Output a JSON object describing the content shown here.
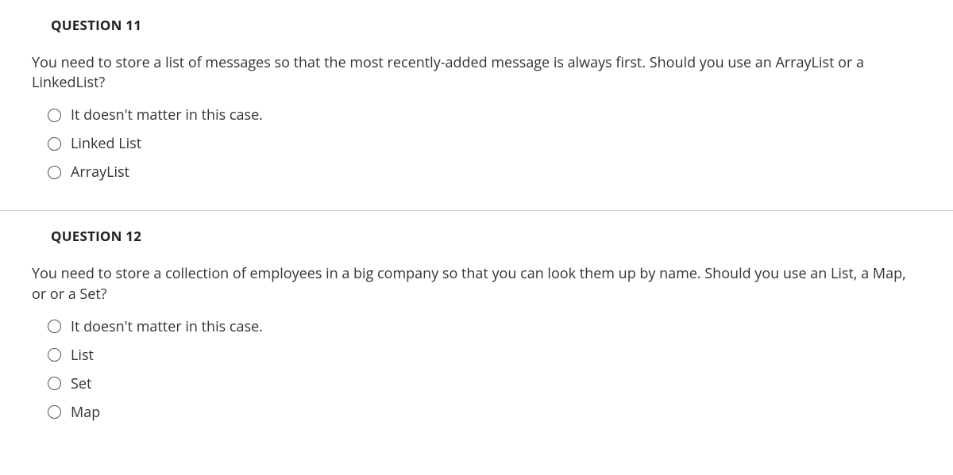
{
  "questions": [
    {
      "title": "QUESTION 11",
      "text": "You need to store a list of messages so that the most recently-added message is always first. Should you use an ArrayList or a LinkedList?",
      "options": [
        "It doesn't matter in this case.",
        "Linked List",
        "ArrayList"
      ]
    },
    {
      "title": "QUESTION 12",
      "text": "You need to store a collection of employees in a big company so that you can look them up by name. Should you use an List, a Map, or or a Set?",
      "options": [
        "It doesn't matter in this case.",
        "List",
        "Set",
        "Map"
      ]
    }
  ]
}
